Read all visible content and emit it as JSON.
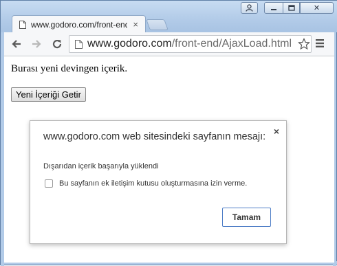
{
  "browser": {
    "tab": {
      "title": "www.godoro.com/front-end/AjaxLoad.html"
    },
    "url": {
      "host": "www.godoro.com",
      "path": "/front-end/AjaxLoad.html"
    }
  },
  "page": {
    "text": "Burası yeni devingen içerik.",
    "button_label": "Yeni İçeriği Getir"
  },
  "dialog": {
    "title": "www.godoro.com web sitesindeki sayfanın mesajı:",
    "message": "Dışarıdan içerik başarıyla yüklendi",
    "checkbox_label": "Bu sayfanın ek iletişim kutusu oluşturmasına izin verme.",
    "checkbox_checked": false,
    "ok_label": "Tamam",
    "close_glyph": "×"
  },
  "icons": {
    "tab_close": "×",
    "caption_close": "✕"
  },
  "colors": {
    "frame": "#b2cbe8",
    "ok_border": "#4d7dc6"
  }
}
